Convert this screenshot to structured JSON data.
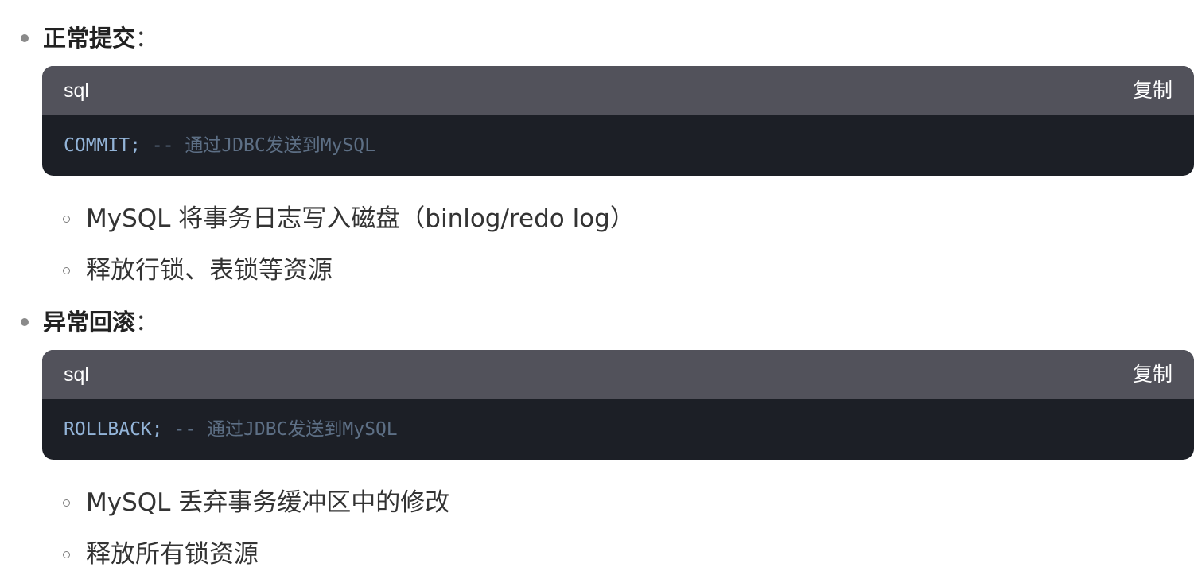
{
  "sections": [
    {
      "title": "正常提交",
      "colon": "：",
      "code": {
        "lang": "sql",
        "copy_label": "复制",
        "keyword": "COMMIT;",
        "comment": "-- 通过JDBC发送到MySQL"
      },
      "items": [
        "MySQL 将事务日志写入磁盘（binlog/redo log）",
        "释放行锁、表锁等资源"
      ]
    },
    {
      "title": "异常回滚",
      "colon": "：",
      "code": {
        "lang": "sql",
        "copy_label": "复制",
        "keyword": "ROLLBACK;",
        "comment": "-- 通过JDBC发送到MySQL"
      },
      "items": [
        "MySQL 丢弃事务缓冲区中的修改",
        "释放所有锁资源"
      ]
    }
  ]
}
